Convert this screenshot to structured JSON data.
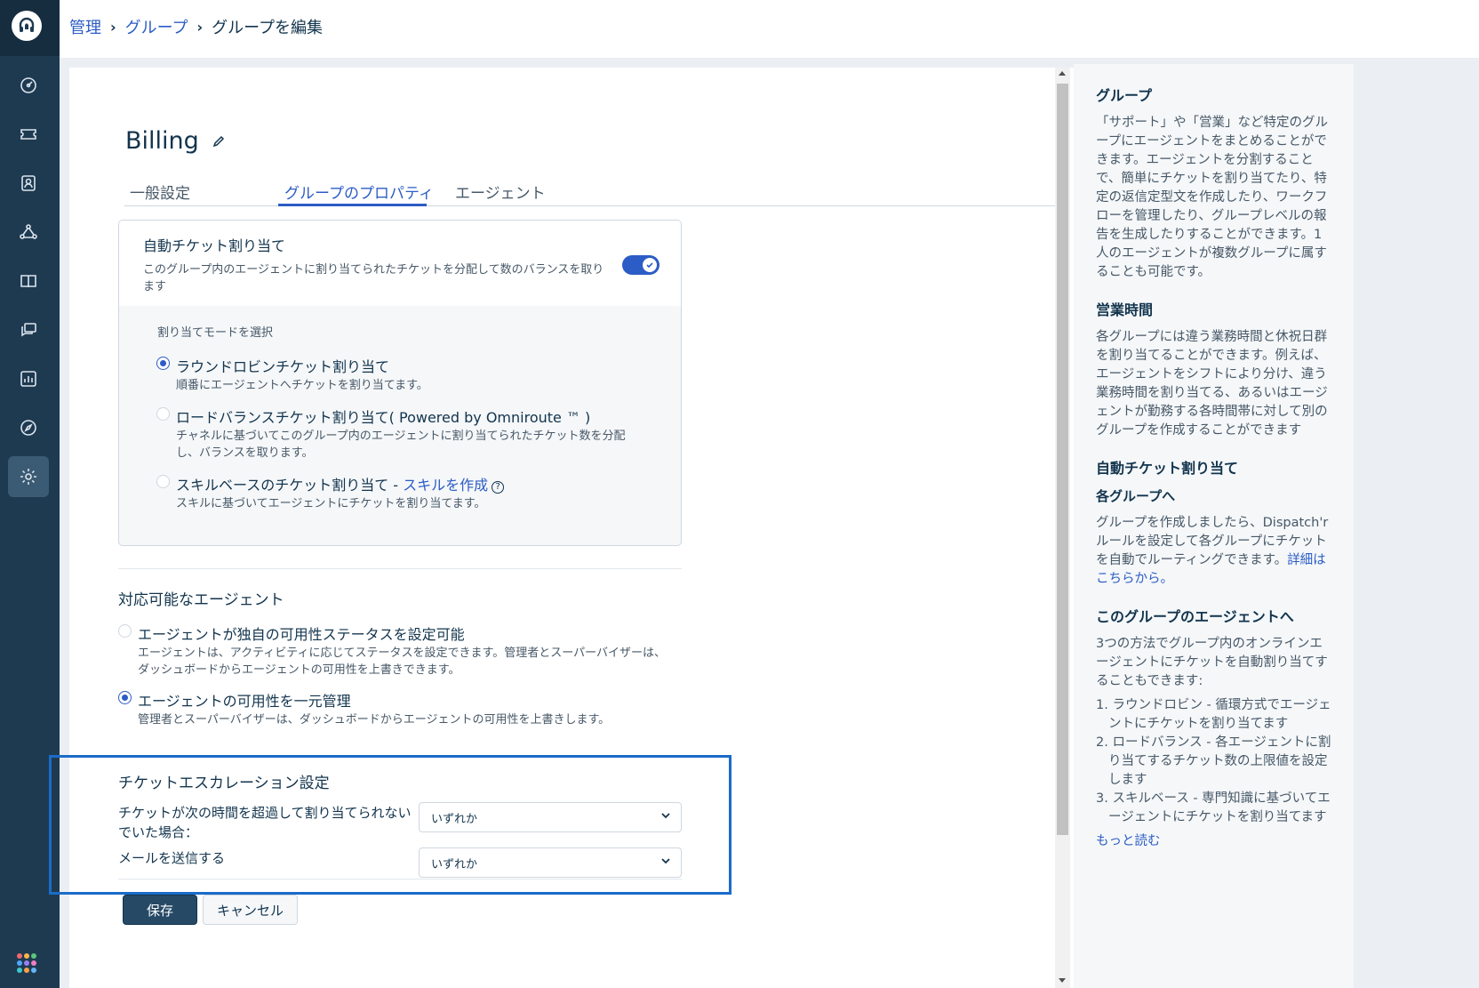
{
  "breadcrumb": {
    "items": [
      "管理",
      "グループ"
    ],
    "current": "グループを編集"
  },
  "page": {
    "title": "Billing"
  },
  "tabs": [
    "一般設定",
    "グループのプロパティ",
    "エージェント"
  ],
  "auto_assign": {
    "title": "自動チケット割り当て",
    "description": "このグループ内のエージェントに割り当てられたチケットを分配して数のバランスを取ります",
    "enabled": true,
    "mode_label": "割り当てモードを選択",
    "options": [
      {
        "label": "ラウンドロビンチケット割り当て",
        "description": "順番にエージェントへチケットを割り当てます。",
        "selected": true
      },
      {
        "label": "ロードバランスチケット割り当て( Powered by Omniroute ™ )",
        "description": "チャネルに基づいてこのグループ内のエージェントに割り当てられたチケット数を分配し、バランスを取ります。",
        "selected": false
      },
      {
        "label": "スキルベースのチケット割り当て - ",
        "link": "スキルを作成",
        "description": "スキルに基づいてエージェントにチケットを割り当てます。",
        "selected": false
      }
    ]
  },
  "availability": {
    "title": "対応可能なエージェント",
    "options": [
      {
        "label": "エージェントが独自の可用性ステータスを設定可能",
        "description": "エージェントは、アクティビティに応じてステータスを設定できます。管理者とスーパーバイザーは、ダッシュボードからエージェントの可用性を上書きできます。",
        "selected": false
      },
      {
        "label": "エージェントの可用性を一元管理",
        "description": "管理者とスーパーバイザーは、ダッシュボードからエージェントの可用性を上書きします。",
        "selected": true
      }
    ]
  },
  "escalation": {
    "title": "チケットエスカレーション設定",
    "row1_label": "チケットが次の時間を超過して割り当てられないでいた場合：",
    "row1_value": "いずれか",
    "row2_label": "メールを送信する",
    "row2_value": "いずれか"
  },
  "buttons": {
    "save": "保存",
    "cancel": "キャンセル"
  },
  "help": {
    "s1_title": "グループ",
    "s1_text": "「サポート」や「営業」など特定のグループにエージェントをまとめることができます。エージェントを分割することで、簡単にチケットを割り当てたり、特定の返信定型文を作成したり、ワークフローを管理したり、グループレベルの報告を生成したりすることができます。1人のエージェントが複数グループに属することも可能です。",
    "s2_title": "営業時間",
    "s2_text": "各グループには違う業務時間と休祝日群を割り当てることができます。例えば、エージェントをシフトにより分け、違う業務時間を割り当てる、あるいはエージェントが勤務する各時間帯に対して別のグループを作成することができます",
    "s3_title": "自動チケット割り当て",
    "s3_subtitle": "各グループへ",
    "s3_text": "グループを作成しましたら、Dispatch'rルールを設定して各グループにチケットを自動でルーティングできます。",
    "s3_link": "詳細はこちらから。",
    "s4_title": "このグループのエージェントへ",
    "s4_text": "3つの方法でグループ内のオンラインエージェントにチケットを自動割り当てすることもできます:",
    "s4_items": [
      "1. ラウンドロビン - 循環方式でエージェントにチケットを割り当てます",
      "2. ロードバランス - 各エージェントに割り当てするチケット数の上限値を設定します",
      "3. スキルベース - 専門知識に基づいてエージェントにチケットを割り当てます"
    ],
    "more_link": "もっと読む"
  },
  "icons": {
    "sidebar": [
      "dashboard-icon",
      "tickets-icon",
      "contacts-icon",
      "groups-icon",
      "solutions-icon",
      "forums-icon",
      "analytics-icon",
      "explore-icon",
      "settings-icon"
    ],
    "apps_colors": [
      "#f0686f",
      "#f8b64c",
      "#5cc67c",
      "#4fa8f7",
      "#9b7ff5",
      "#f07fc4",
      "#3dc7c9",
      "#f5a04b",
      "#64b5f6"
    ]
  }
}
